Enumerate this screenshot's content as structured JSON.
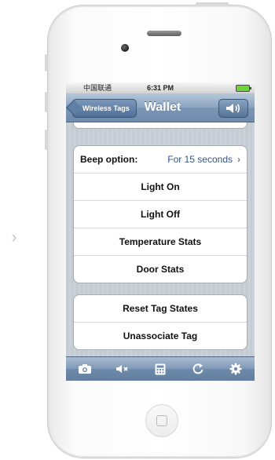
{
  "status_bar": {
    "carrier": "中国联通",
    "time": "6:31 PM"
  },
  "nav": {
    "back_label": "Wireless Tags",
    "title": "Wallet",
    "sound_icon": "speaker-icon"
  },
  "beep_option": {
    "label": "Beep option:",
    "value": "For 15 seconds"
  },
  "actions": [
    "Light On",
    "Light Off",
    "Temperature Stats",
    "Door Stats"
  ],
  "tag_actions": [
    "Reset Tag States",
    "Unassociate Tag"
  ],
  "toolbar": {
    "icons": [
      "camera-icon",
      "mute-icon",
      "calculator-icon",
      "refresh-icon",
      "gear-icon"
    ]
  },
  "colors": {
    "nav_blue": "#7b96b5",
    "value_blue": "#385487",
    "battery_green": "#6fd43a"
  }
}
